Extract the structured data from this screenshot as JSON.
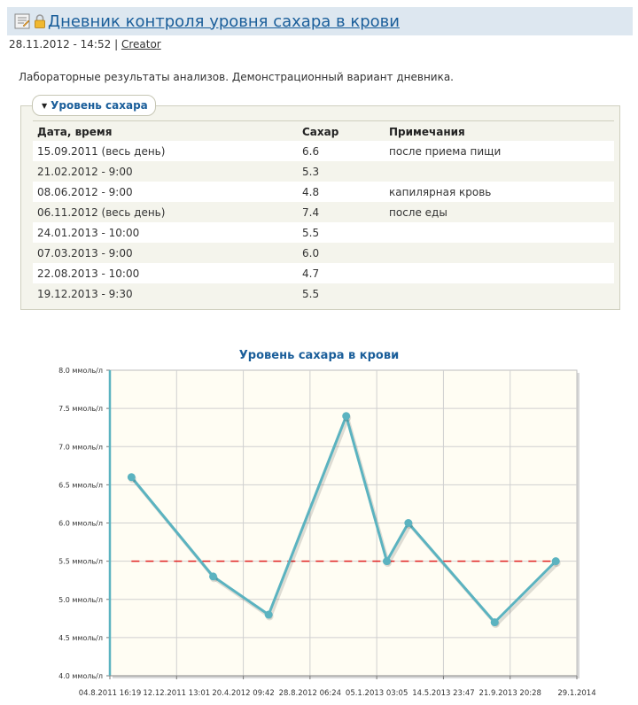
{
  "header": {
    "title": "Дневник контроля уровня сахара в крови",
    "date": "28.11.2012 - 14:52",
    "separator": "|",
    "author": "Creator",
    "icons": [
      "note-icon",
      "lock-icon"
    ]
  },
  "description": "Лабораторные результаты анализов. Демонстрационный вариант дневника.",
  "panel": {
    "label": "Уровень сахара",
    "columns": [
      "Дата, время",
      "Сахар",
      "Примечания"
    ],
    "rows": [
      [
        "15.09.2011 (весь день)",
        "6.6",
        "после приема пищи"
      ],
      [
        "21.02.2012 - 9:00",
        "5.3",
        ""
      ],
      [
        "08.06.2012 - 9:00",
        "4.8",
        "капилярная кровь"
      ],
      [
        "06.11.2012 (весь день)",
        "7.4",
        "после еды"
      ],
      [
        "24.01.2013 - 10:00",
        "5.5",
        ""
      ],
      [
        "07.03.2013 - 9:00",
        "6.0",
        ""
      ],
      [
        "22.08.2013 - 10:00",
        "4.7",
        ""
      ],
      [
        "19.12.2013 - 9:30",
        "5.5",
        ""
      ]
    ]
  },
  "chart_data": {
    "type": "line",
    "title": "Уровень сахара в крови",
    "x": [
      "15.09.2011",
      "21.02.2012",
      "08.06.2012",
      "06.11.2012",
      "24.01.2013",
      "07.03.2013",
      "22.08.2013",
      "19.12.2013"
    ],
    "series": [
      {
        "values": [
          6.6,
          5.3,
          4.8,
          7.4,
          5.5,
          6.0,
          4.7,
          5.5
        ]
      }
    ],
    "reference_line": 5.5,
    "ylim": [
      4.0,
      8.0
    ],
    "y_ticks": [
      "4.0 ммоль/л",
      "4.5 ммоль/л",
      "5.0 ммоль/л",
      "5.5 ммоль/л",
      "6.0 ммоль/л",
      "6.5 ммоль/л",
      "7.0 ммоль/л",
      "7.5 ммоль/л",
      "8.0 ммоль/л"
    ],
    "x_ticks": [
      "04.8.2011 16:19",
      "12.12.2011 13:01",
      "20.4.2012 09:42",
      "28.8.2012 06:24",
      "05.1.2013 03:05",
      "14.5.2013 23:47",
      "21.9.2013 20:28",
      "29.1.2014"
    ],
    "x_range": [
      "2011-08-04",
      "2014-01-29"
    ],
    "grid": true,
    "colors": {
      "line": "#5bb3c0",
      "reference": "#e02020",
      "plot_bg": "#fffdf3",
      "grid": "#d0d0d0"
    }
  }
}
